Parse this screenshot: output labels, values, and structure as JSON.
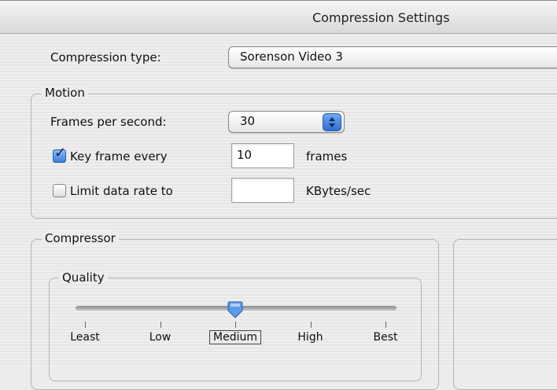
{
  "window": {
    "title": "Compression Settings"
  },
  "compression": {
    "type_label": "Compression type:",
    "type_value": "Sorenson Video 3"
  },
  "motion": {
    "group_label": "Motion",
    "fps_label": "Frames per second:",
    "fps_value": "30",
    "keyframe_label": "Key frame every",
    "keyframe_checked": true,
    "keyframe_value": "10",
    "keyframe_unit": "frames",
    "limit_label": "Limit data rate to",
    "limit_checked": false,
    "limit_value": "",
    "limit_unit": "KBytes/sec"
  },
  "compressor": {
    "group_label": "Compressor",
    "quality": {
      "group_label": "Quality",
      "levels": [
        "Least",
        "Low",
        "Medium",
        "High",
        "Best"
      ],
      "selected": "Medium",
      "level_value": 0.5
    }
  },
  "colors": {
    "accent": "#3a7fd8",
    "slider_thumb": "#5b9bea"
  }
}
